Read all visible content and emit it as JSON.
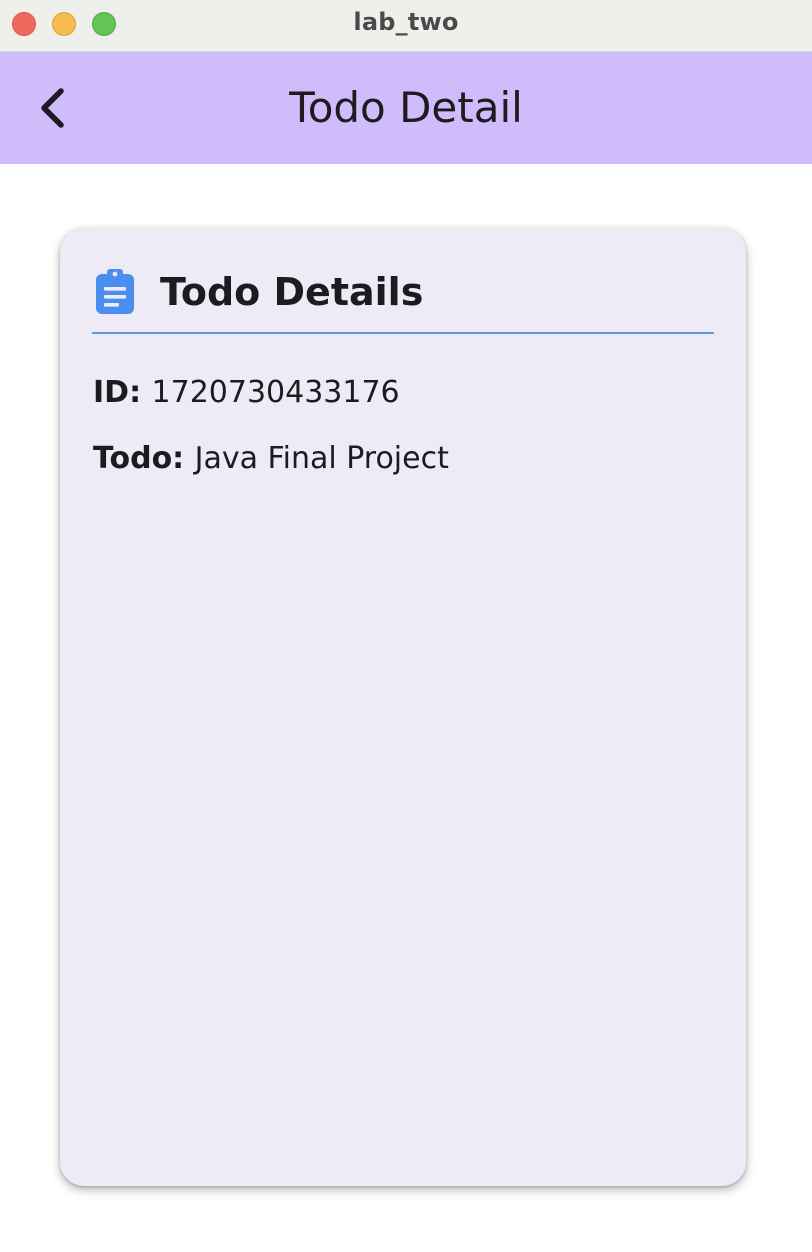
{
  "window": {
    "title": "lab_two"
  },
  "appbar": {
    "title": "Todo Detail",
    "back_icon": "chevron-left-icon",
    "background_color": "#d0bcfa"
  },
  "card": {
    "icon": "clipboard-icon",
    "icon_color": "#4a8ff0",
    "title": "Todo Details",
    "divider_color": "#5b9be0",
    "fields": {
      "id_label": "ID:",
      "id_value": "1720730433176",
      "todo_label": "Todo:",
      "todo_value": "Java Final Project"
    }
  }
}
